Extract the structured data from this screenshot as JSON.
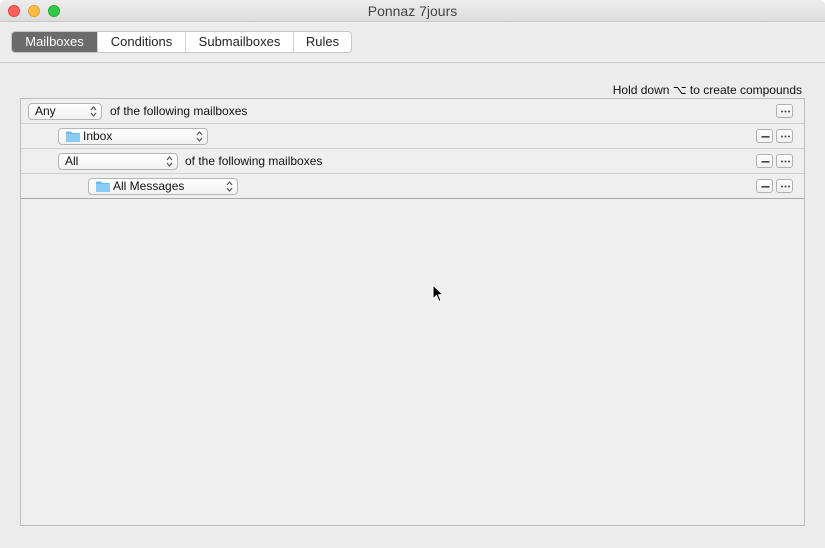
{
  "window": {
    "title": "Ponnaz 7jours"
  },
  "tabs": [
    {
      "label": "Mailboxes",
      "active": true
    },
    {
      "label": "Conditions",
      "active": false
    },
    {
      "label": "Submailboxes",
      "active": false
    },
    {
      "label": "Rules",
      "active": false
    }
  ],
  "hint": "Hold down ⌥ to create compounds",
  "rows": [
    {
      "selector": "Any",
      "text": "of the following mailboxes"
    },
    {
      "mailbox": "Inbox"
    },
    {
      "selector": "All",
      "text": "of the following mailboxes"
    },
    {
      "mailbox": "All Messages"
    }
  ],
  "colors": {
    "active_tab": "#6b6b6b",
    "folder": "#6ab9f0",
    "close": "#fc605c",
    "minimize": "#fdbc40",
    "maximize": "#34c84a"
  }
}
